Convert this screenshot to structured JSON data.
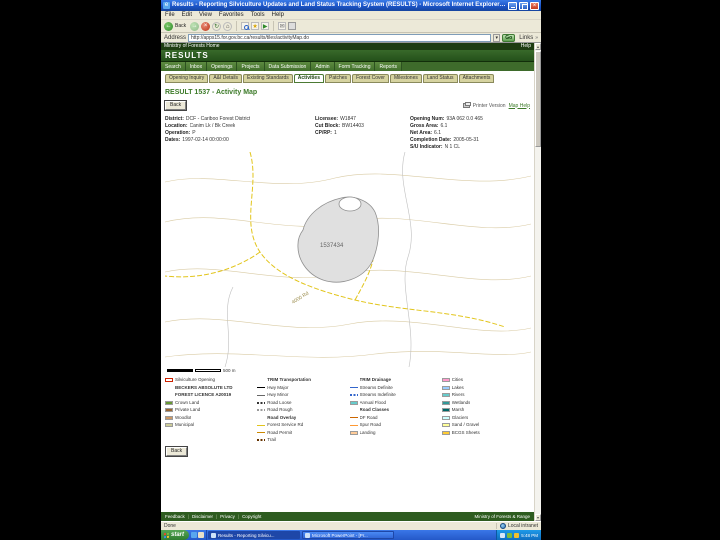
{
  "titlebar": {
    "title": "Results - Reporting Silviculture Updates and Land Status Tracking System (RESULTS) - Microsoft Internet Explorer provided by Shared Serv"
  },
  "menubar": {
    "items": [
      "File",
      "Edit",
      "View",
      "Favorites",
      "Tools",
      "Help"
    ]
  },
  "toolbar": {
    "back_label": "Back"
  },
  "addressbar": {
    "label": "Address",
    "url": "http://apps15.for.gov.bc.ca/results/tiles/activityMap.do",
    "go": "Go",
    "links": "Links"
  },
  "gov_strip": {
    "left": "Ministry of Forests Home",
    "right": "Help"
  },
  "banner": {
    "app_name": "RESULTS"
  },
  "nav_tabs": [
    "Search",
    "Inbox",
    "Openings",
    "Projects",
    "Data Submission",
    "Admin",
    "Form Tracking",
    "Reports"
  ],
  "sub_tabs": [
    {
      "label": "Opening Inquiry"
    },
    {
      "label": "A&I Details"
    },
    {
      "label": "Existing Standards"
    },
    {
      "label": "Activities",
      "active": true
    },
    {
      "label": "Patches"
    },
    {
      "label": "Forest Cover"
    },
    {
      "label": "Milestones"
    },
    {
      "label": "Land Status"
    },
    {
      "label": "Attachments"
    }
  ],
  "page": {
    "title": "RESULT 1537 - Activity Map",
    "back_button": "Back",
    "printer_version": "Printer Version",
    "map_help": "Map Help"
  },
  "details": {
    "col1": [
      {
        "label": "District:",
        "value": "DCF - Cariboo Forest District"
      },
      {
        "label": "Location:",
        "value": "Canim Lk / Bk Creek"
      },
      {
        "label": "Operation:",
        "value": "P"
      },
      {
        "label": "Dates:",
        "value": "1997-02-14 00:00:00"
      }
    ],
    "col2": [
      {
        "label": "Licensee:",
        "value": "W1847"
      },
      {
        "label": "Cut Block:",
        "value": "BW14403"
      },
      {
        "label": "CP/RP:",
        "value": "1"
      }
    ],
    "col3": [
      {
        "label": "Opening Num:",
        "value": "93A 062 0.0 465"
      },
      {
        "label": "Gross Area:",
        "value": "6.1"
      },
      {
        "label": "Net Area:",
        "value": "6.1"
      },
      {
        "label": "Completion Date:",
        "value": "2005-05-31"
      },
      {
        "label": "S/U Indicator:",
        "value": "N 1 CL"
      }
    ]
  },
  "map": {
    "opening_label": "1537434",
    "road_label": "4000 Rd",
    "scale_label": "500 m"
  },
  "legend": {
    "col1": [
      {
        "t": "boxo",
        "c": "#FFFFFF",
        "b": "#CC2200",
        "label": "Silviculture Opening"
      },
      {
        "t": "hdr",
        "label": "BECKERS ABSOLUTE LTD"
      },
      {
        "t": "hdr",
        "label": "FOREST LICENCE A20019"
      },
      {
        "t": "box",
        "c": "#669933",
        "label": "Crown Land"
      },
      {
        "t": "box",
        "c": "#996633",
        "label": "Private Land"
      },
      {
        "t": "box",
        "c": "#CC9966",
        "label": "Woodlot"
      },
      {
        "t": "box",
        "c": "#CCCC99",
        "label": "Municipal"
      }
    ],
    "col2": [
      {
        "t": "hdr",
        "label": "TRIM Transportation"
      },
      {
        "t": "line",
        "c": "#000000",
        "label": "Hwy Major"
      },
      {
        "t": "line",
        "c": "#666666",
        "label": "Hwy Minor"
      },
      {
        "t": "dash",
        "c": "#333333",
        "label": "Road Loose"
      },
      {
        "t": "dash",
        "c": "#999999",
        "label": "Road Rough"
      },
      {
        "t": "hdr",
        "label": "Road Overlay"
      },
      {
        "t": "line",
        "c": "#E2C51C",
        "label": "Forest Service Rd"
      },
      {
        "t": "line",
        "c": "#CC8800",
        "label": "Road Permit"
      },
      {
        "t": "dash",
        "c": "#663300",
        "label": "Trail"
      }
    ],
    "col3": [
      {
        "t": "hdr",
        "label": "TRIM Drainage"
      },
      {
        "t": "line",
        "c": "#3366CC",
        "label": "Streams Definite"
      },
      {
        "t": "dash",
        "c": "#3366CC",
        "label": "Streams Indefinite"
      },
      {
        "t": "box",
        "c": "#66CCCC",
        "label": "Annual Flood"
      },
      {
        "t": "hdr",
        "label": "Road Classes"
      },
      {
        "t": "line",
        "c": "#CC6600",
        "label": "DF Road"
      },
      {
        "t": "line",
        "c": "#FF9933",
        "label": "Spur Road"
      },
      {
        "t": "box",
        "c": "#FFCC99",
        "label": "Landing"
      }
    ],
    "col4": [
      {
        "t": "box",
        "c": "#FF99CC",
        "label": "Cities"
      },
      {
        "t": "box",
        "c": "#99CCFF",
        "label": "Lakes"
      },
      {
        "t": "box",
        "c": "#66CCCC",
        "label": "Rivers"
      },
      {
        "t": "box",
        "c": "#339999",
        "label": "Wetlands"
      },
      {
        "t": "box",
        "c": "#006666",
        "label": "Marsh"
      },
      {
        "t": "box",
        "c": "#CCFFFF",
        "label": "Glaciers"
      },
      {
        "t": "box",
        "c": "#FFFF99",
        "label": "Sand / Gravel"
      },
      {
        "t": "box",
        "c": "#FFCC33",
        "label": "BCGS Sheets"
      }
    ]
  },
  "bottom_back_button": "Back",
  "footer": {
    "links": [
      "Feedback",
      "Disclaimer",
      "Privacy",
      "Copyright"
    ],
    "right": "Ministry of Forests & Range"
  },
  "statusbar": {
    "left": "Done",
    "right": "Local intranet"
  },
  "taskbar": {
    "start": "start",
    "tasks": [
      {
        "label": "Results - Reporting Silvicu...",
        "active": true
      },
      {
        "label": "Microsoft PowerPoint - [Pr..."
      }
    ],
    "time": "5:48 PM"
  }
}
